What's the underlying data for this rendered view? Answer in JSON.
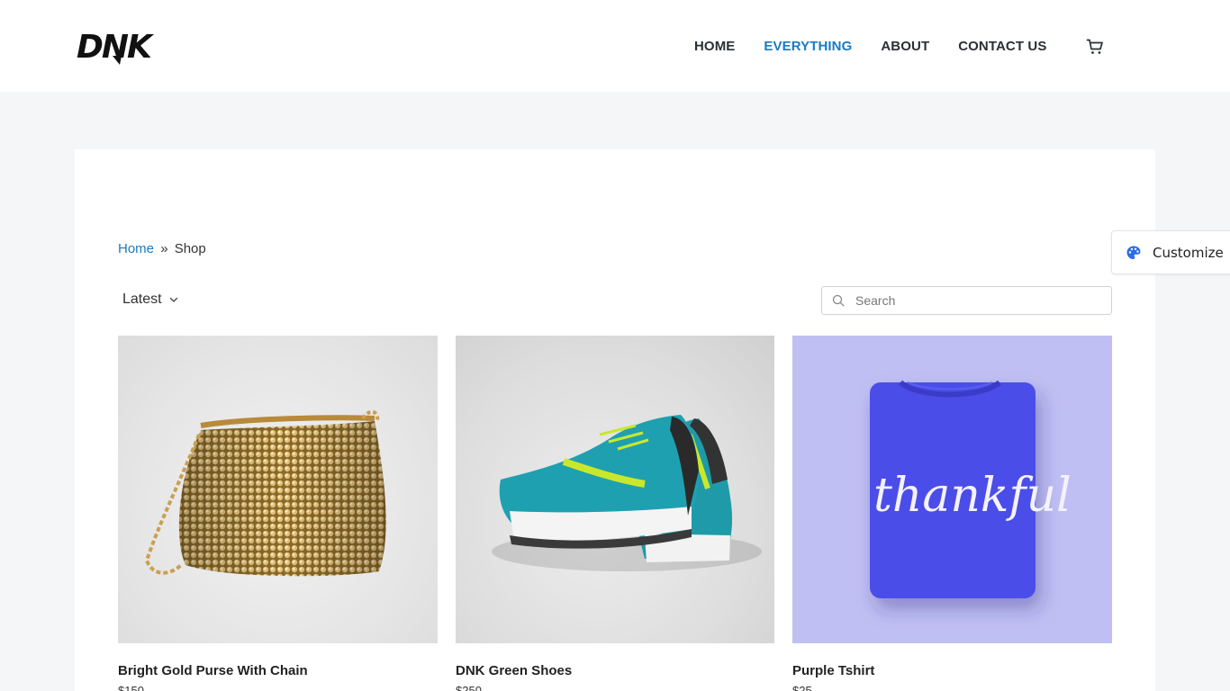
{
  "brand": {
    "logo_text": "DNK"
  },
  "nav": {
    "items": [
      {
        "label": "HOME",
        "active": false
      },
      {
        "label": "EVERYTHING",
        "active": true
      },
      {
        "label": "ABOUT",
        "active": false
      },
      {
        "label": "CONTACT US",
        "active": false
      }
    ],
    "cart_icon": "cart-icon"
  },
  "breadcrumb": {
    "home": "Home",
    "separator": "»",
    "current": "Shop"
  },
  "toolbar": {
    "sort_label": "Latest",
    "search_placeholder": "Search"
  },
  "customize": {
    "label": "Customize",
    "icon": "palette-icon"
  },
  "products": [
    {
      "name": "Bright Gold Purse With Chain",
      "price": "$150"
    },
    {
      "name": "DNK Green Shoes",
      "price": "$250"
    },
    {
      "name": "Purple Tshirt",
      "price": "$25"
    }
  ],
  "tshirt_print": "thankful",
  "colors": {
    "accent": "#1a7bc1",
    "page_bg": "#f5f6f8",
    "tee_bg": "#c0bff3",
    "tee": "#4b4ee8"
  }
}
